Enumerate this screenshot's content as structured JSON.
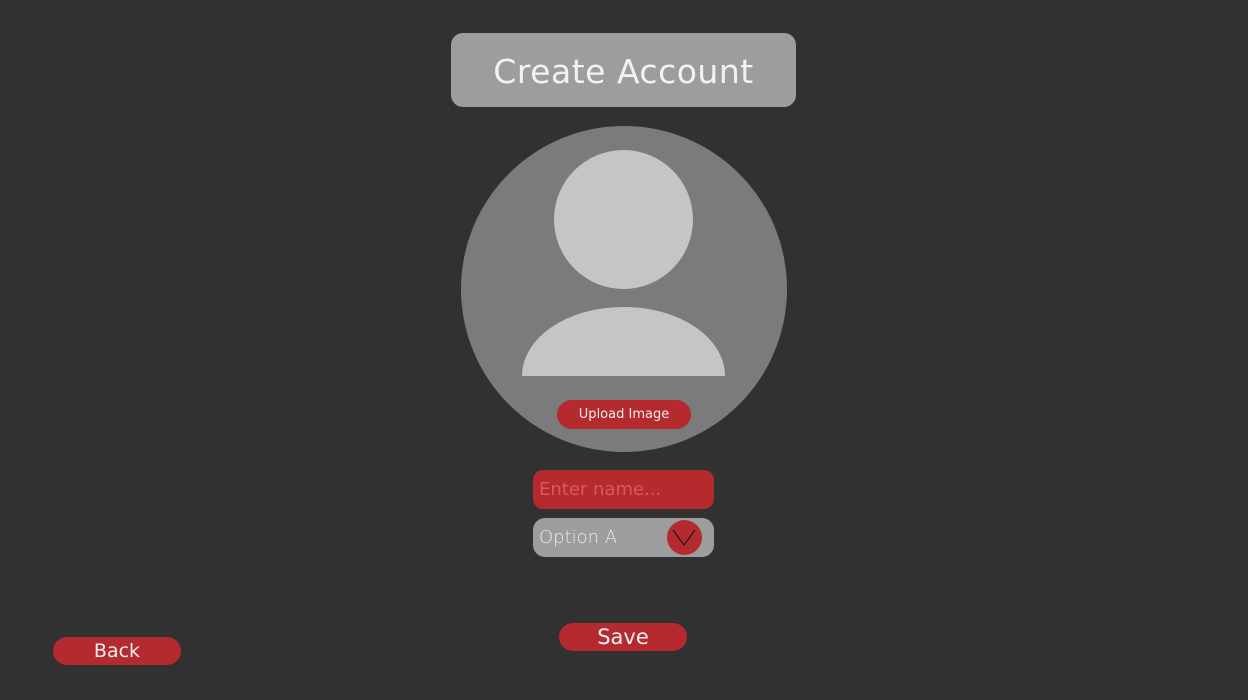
{
  "header": {
    "title": "Create Account"
  },
  "avatar": {
    "icon": "user-silhouette-icon",
    "upload_label": "Upload Image"
  },
  "form": {
    "name_placeholder": "Enter name...",
    "name_value": "",
    "select_value": "Option A",
    "select_icon": "chevron-down-icon"
  },
  "footer": {
    "save_label": "Save",
    "back_label": "Back"
  },
  "colors": {
    "background": "#313131",
    "accent": "#b52a2e",
    "panel": "#9d9d9d",
    "avatar_bg": "#7b7b7b",
    "avatar_fg": "#c5c5c5"
  }
}
